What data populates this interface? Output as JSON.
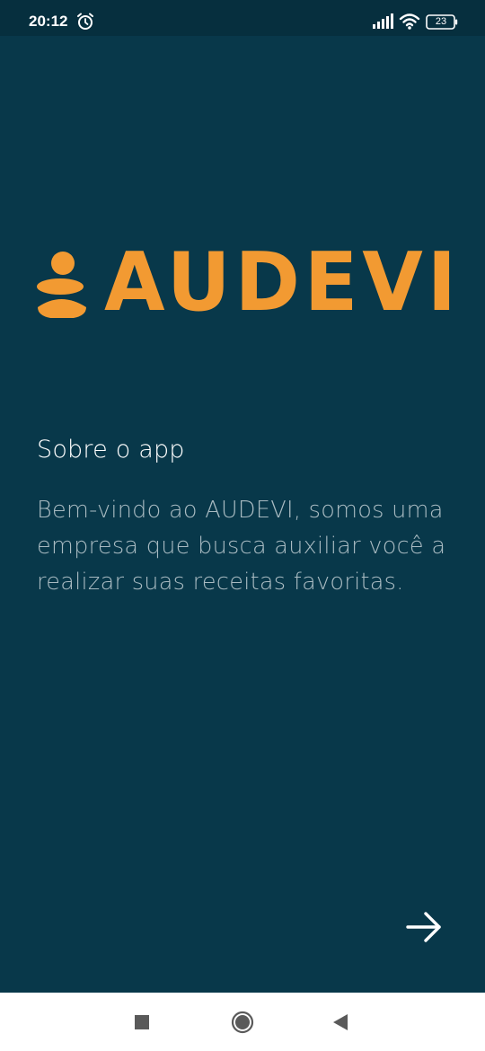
{
  "status_bar": {
    "time": "20:12",
    "battery": "23",
    "icons": [
      "alarm-icon",
      "signal-icon",
      "wifi-icon",
      "battery-icon"
    ]
  },
  "logo": {
    "text": "AUDEVI",
    "color": "#f29a32"
  },
  "about": {
    "title": "Sobre o app",
    "body": "Bem-vindo ao AUDEVI, somos uma empresa que busca auxiliar você a realizar suas receitas favoritas."
  },
  "next_button": {
    "icon": "arrow-right-icon"
  },
  "nav_bar": {
    "icons": [
      "recents-icon",
      "home-icon",
      "back-icon"
    ]
  },
  "colors": {
    "background": "#08384a",
    "status_bar": "#062f3e",
    "accent": "#f29a32",
    "body_text": "#a9bbc2"
  }
}
